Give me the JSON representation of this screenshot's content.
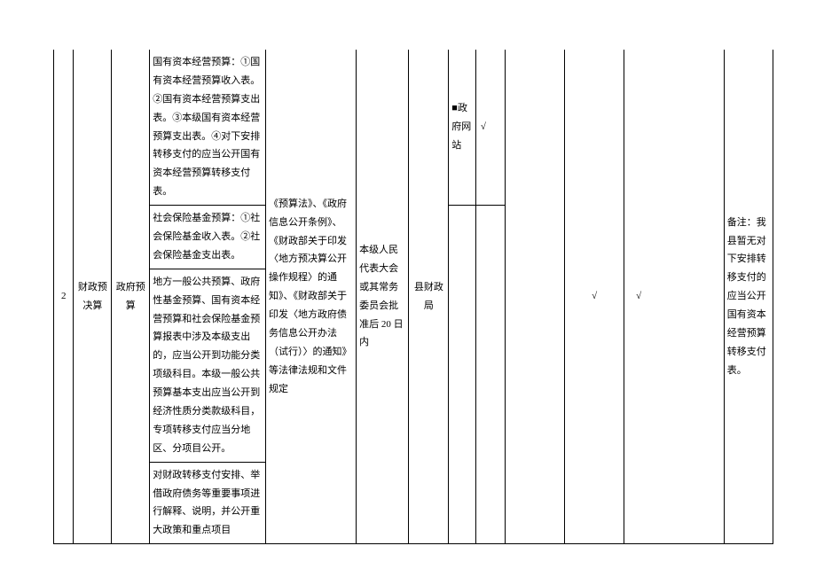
{
  "row": {
    "index": "2",
    "col1": "财政预决算",
    "col2": "政府预算",
    "content_top": "国有资本经营预算：①国有资本经营预算收入表。②国有资本经营预算支出表。③本级国有资本经营预算支出表。④对下安排转移支付的应当公开国有资本经营预算转移支付表。",
    "content_p1": "社会保险基金预算：①社会保险基金收入表。②社会保险基金支出表。",
    "content_p2": "地方一般公共预算、政府性基金预算、国有资本经营预算和社会保险基金预算报表中涉及本级支出的，应当公开到功能分类项级科目。本级一般公共预算基本支出应当公开到经济性质分类款级科目，专项转移支付应当分地区、分项目公开。",
    "content_p3": "对财政转移支付安排、举借政府债务等重要事项进行解释、说明，并公开重大政策和重点项目",
    "basis": "《预算法》、《政府信息公开条例》、《财政部关于印发〈地方预决算公开操作规程〉的通知》、《财政部关于印发〈地方政府债务信息公开办法（试行）〉的通知》等法律法规和文件规定",
    "timing": "本级人民代表大会或其常务委员会批准后 20 日内",
    "dept": "县财政局",
    "channel": "■政府网站",
    "check1": "√",
    "check2": "√",
    "check3": "√",
    "remark": "备注：我县暂无对下安排转移支付的应当公开国有资本经营预算转移支付表。"
  }
}
